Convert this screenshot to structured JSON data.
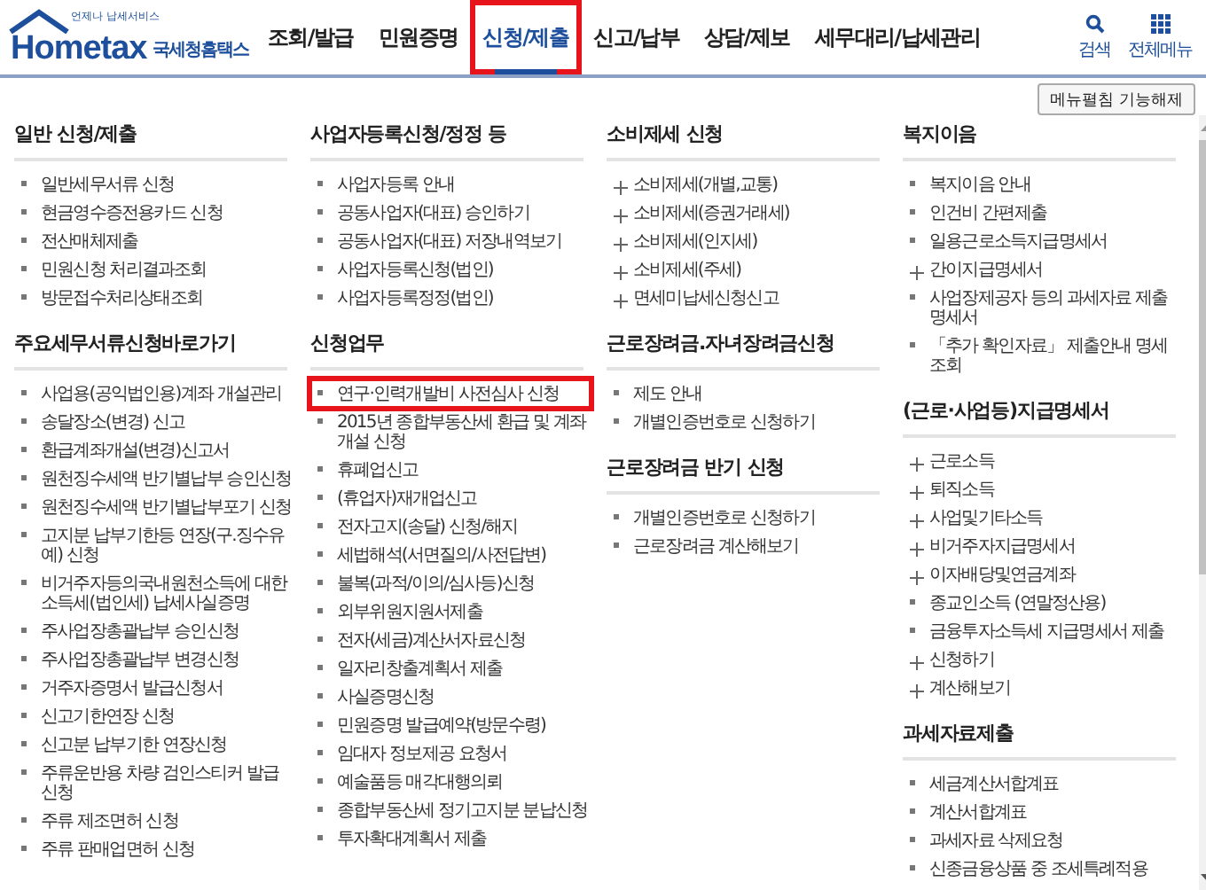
{
  "logo": {
    "tagline": "언제나 납세서비스",
    "wordmark": "Hometax",
    "name": "국세청홈택스"
  },
  "tabs": [
    {
      "label": "조회/발급",
      "selected": false,
      "highlighted": false
    },
    {
      "label": "민원증명",
      "selected": false,
      "highlighted": false
    },
    {
      "label": "신청/제출",
      "selected": true,
      "highlighted": true
    },
    {
      "label": "신고/납부",
      "selected": false,
      "highlighted": false
    },
    {
      "label": "상담/제보",
      "selected": false,
      "highlighted": false
    },
    {
      "label": "세무대리/납세관리",
      "selected": false,
      "highlighted": false
    }
  ],
  "header_tools": [
    {
      "kind": "search",
      "label": "검색"
    },
    {
      "kind": "all-menu",
      "label": "전체메뉴"
    }
  ],
  "pin_button": "메뉴펼침 기능해제",
  "columns": [
    [
      {
        "title": "일반 신청/제출",
        "items": [
          {
            "label": "일반세무서류 신청",
            "kind": "link",
            "highlighted": false
          },
          {
            "label": "현금영수증전용카드 신청",
            "kind": "link",
            "highlighted": false
          },
          {
            "label": "전산매체제출",
            "kind": "link",
            "highlighted": false
          },
          {
            "label": "민원신청 처리결과조회",
            "kind": "link",
            "highlighted": false
          },
          {
            "label": "방문접수처리상태조회",
            "kind": "link",
            "highlighted": false
          }
        ]
      },
      {
        "title": "주요세무서류신청바로가기",
        "items": [
          {
            "label": "사업용(공익법인용)계좌 개설관리",
            "kind": "link",
            "highlighted": false
          },
          {
            "label": "송달장소(변경) 신고",
            "kind": "link",
            "highlighted": false
          },
          {
            "label": "환급계좌개설(변경)신고서",
            "kind": "link",
            "highlighted": false
          },
          {
            "label": "원천징수세액 반기별납부 승인신청",
            "kind": "link",
            "highlighted": false
          },
          {
            "label": "원천징수세액 반기별납부포기 신청",
            "kind": "link",
            "highlighted": false
          },
          {
            "label": "고지분 납부기한등 연장(구.징수유예) 신청",
            "kind": "link",
            "highlighted": false
          },
          {
            "label": "비거주자등의국내원천소득에 대한 소득세(법인세) 납세사실증명",
            "kind": "link",
            "highlighted": false
          },
          {
            "label": "주사업장총괄납부 승인신청",
            "kind": "link",
            "highlighted": false
          },
          {
            "label": "주사업장총괄납부 변경신청",
            "kind": "link",
            "highlighted": false
          },
          {
            "label": "거주자증명서 발급신청서",
            "kind": "link",
            "highlighted": false
          },
          {
            "label": "신고기한연장 신청",
            "kind": "link",
            "highlighted": false
          },
          {
            "label": "신고분 납부기한 연장신청",
            "kind": "link",
            "highlighted": false
          },
          {
            "label": "주류운반용 차량 검인스티커 발급신청",
            "kind": "link",
            "highlighted": false
          },
          {
            "label": "주류 제조면허 신청",
            "kind": "link",
            "highlighted": false
          },
          {
            "label": "주류 판매업면허 신청",
            "kind": "link",
            "highlighted": false
          }
        ]
      }
    ],
    [
      {
        "title": "사업자등록신청/정정 등",
        "items": [
          {
            "label": "사업자등록 안내",
            "kind": "link",
            "highlighted": false
          },
          {
            "label": "공동사업자(대표) 승인하기",
            "kind": "link",
            "highlighted": false
          },
          {
            "label": "공동사업자(대표) 저장내역보기",
            "kind": "link",
            "highlighted": false
          },
          {
            "label": "사업자등록신청(법인)",
            "kind": "link",
            "highlighted": false
          },
          {
            "label": "사업자등록정정(법인)",
            "kind": "link",
            "highlighted": false
          }
        ]
      },
      {
        "title": "신청업무",
        "items": [
          {
            "label": "연구·인력개발비 사전심사 신청",
            "kind": "link",
            "highlighted": true
          },
          {
            "label": "2015년 종합부동산세 환급 및 계좌개설 신청",
            "kind": "link",
            "highlighted": false
          },
          {
            "label": "휴폐업신고",
            "kind": "link",
            "highlighted": false
          },
          {
            "label": "(휴업자)재개업신고",
            "kind": "link",
            "highlighted": false
          },
          {
            "label": "전자고지(송달) 신청/해지",
            "kind": "link",
            "highlighted": false
          },
          {
            "label": "세법해석(서면질의/사전답변)",
            "kind": "link",
            "highlighted": false
          },
          {
            "label": "불복(과적/이의/심사등)신청",
            "kind": "link",
            "highlighted": false
          },
          {
            "label": "외부위원지원서제출",
            "kind": "link",
            "highlighted": false
          },
          {
            "label": "전자(세금)계산서자료신청",
            "kind": "link",
            "highlighted": false
          },
          {
            "label": "일자리창출계획서 제출",
            "kind": "link",
            "highlighted": false
          },
          {
            "label": "사실증명신청",
            "kind": "link",
            "highlighted": false
          },
          {
            "label": "민원증명 발급예약(방문수령)",
            "kind": "link",
            "highlighted": false
          },
          {
            "label": "임대자 정보제공 요청서",
            "kind": "link",
            "highlighted": false
          },
          {
            "label": "예술품등 매각대행의뢰",
            "kind": "link",
            "highlighted": false
          },
          {
            "label": "종합부동산세 정기고지분 분납신청",
            "kind": "link",
            "highlighted": false
          },
          {
            "label": "투자확대계획서 제출",
            "kind": "link",
            "highlighted": false
          }
        ]
      }
    ],
    [
      {
        "title": "소비제세 신청",
        "items": [
          {
            "label": "소비제세(개별,교통)",
            "kind": "expand",
            "highlighted": false
          },
          {
            "label": "소비제세(증권거래세)",
            "kind": "expand",
            "highlighted": false
          },
          {
            "label": "소비제세(인지세)",
            "kind": "expand",
            "highlighted": false
          },
          {
            "label": "소비제세(주세)",
            "kind": "expand",
            "highlighted": false
          },
          {
            "label": "면세미납세신청신고",
            "kind": "expand",
            "highlighted": false
          }
        ]
      },
      {
        "title": "근로장려금.자녀장려금신청",
        "items": [
          {
            "label": "제도 안내",
            "kind": "link",
            "highlighted": false
          },
          {
            "label": "개별인증번호로 신청하기",
            "kind": "link",
            "highlighted": false
          }
        ]
      },
      {
        "title": "근로장려금 반기 신청",
        "items": [
          {
            "label": "개별인증번호로 신청하기",
            "kind": "link",
            "highlighted": false
          },
          {
            "label": "근로장려금 계산해보기",
            "kind": "link",
            "highlighted": false
          }
        ]
      }
    ],
    [
      {
        "title": "복지이음",
        "items": [
          {
            "label": "복지이음 안내",
            "kind": "link",
            "highlighted": false
          },
          {
            "label": "인건비 간편제출",
            "kind": "link",
            "highlighted": false
          },
          {
            "label": "일용근로소득지급명세서",
            "kind": "link",
            "highlighted": false
          },
          {
            "label": "간이지급명세서",
            "kind": "expand",
            "highlighted": false
          },
          {
            "label": "사업장제공자 등의 과세자료 제출명세서",
            "kind": "link",
            "highlighted": false
          },
          {
            "label": "「추가 확인자료」 제출안내 명세 조회",
            "kind": "link",
            "highlighted": false
          }
        ]
      },
      {
        "title": "(근로·사업등)지급명세서",
        "items": [
          {
            "label": "근로소득",
            "kind": "expand",
            "highlighted": false
          },
          {
            "label": "퇴직소득",
            "kind": "expand",
            "highlighted": false
          },
          {
            "label": "사업및기타소득",
            "kind": "expand",
            "highlighted": false
          },
          {
            "label": "비거주자지급명세서",
            "kind": "expand",
            "highlighted": false
          },
          {
            "label": "이자배당및연금계좌",
            "kind": "expand",
            "highlighted": false
          },
          {
            "label": "종교인소득 (연말정산용)",
            "kind": "link",
            "highlighted": false
          },
          {
            "label": "금융투자소득세 지급명세서 제출",
            "kind": "link",
            "highlighted": false
          },
          {
            "label": "신청하기",
            "kind": "expand",
            "highlighted": false
          },
          {
            "label": "계산해보기",
            "kind": "expand",
            "highlighted": false
          }
        ]
      },
      {
        "title": "과세자료제출",
        "items": [
          {
            "label": "세금계산서합계표",
            "kind": "link",
            "highlighted": false
          },
          {
            "label": "계산서합계표",
            "kind": "link",
            "highlighted": false
          },
          {
            "label": "과세자료 삭제요청",
            "kind": "link",
            "highlighted": false
          },
          {
            "label": "신종금융상품 중 조세특례적용",
            "kind": "link",
            "highlighted": false
          }
        ]
      }
    ]
  ]
}
